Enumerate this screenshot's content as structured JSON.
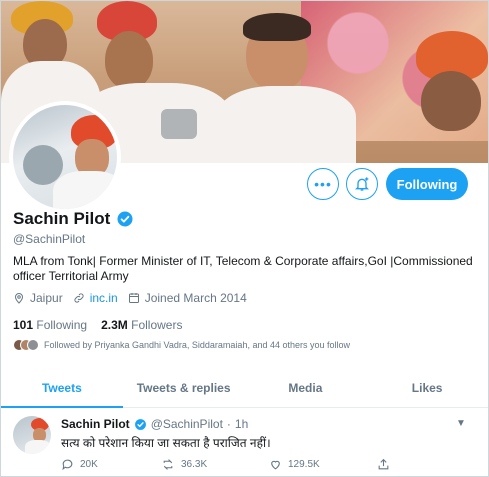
{
  "header": {
    "banner_alt": "",
    "buttons": {
      "more_icon": "more-horizontal-icon",
      "notify_icon": "bell-plus-icon",
      "follow_label": "Following"
    }
  },
  "profile": {
    "name": "Sachin Pilot",
    "verified_icon": "verified-badge-icon",
    "handle": "@SachinPilot",
    "bio": "MLA from Tonk| Former Minister of IT, Telecom & Corporate affairs,GoI |Commissioned officer Territorial Army",
    "location": "Jaipur",
    "website": "inc.in",
    "joined": "Joined March 2014",
    "following_count": "101",
    "following_label": "Following",
    "followers_count": "2.3M",
    "followers_label": "Followers",
    "followed_by": "Followed by Priyanka Gandhi Vadra, Siddaramaiah, and 44 others you follow"
  },
  "tabs": [
    {
      "label": "Tweets",
      "active": true
    },
    {
      "label": "Tweets & replies",
      "active": false
    },
    {
      "label": "Media",
      "active": false
    },
    {
      "label": "Likes",
      "active": false
    }
  ],
  "tweet": {
    "name": "Sachin Pilot",
    "handle": "@SachinPilot",
    "separator": "·",
    "time": "1h",
    "text": "सत्य को परेशान किया जा सकता है पराजित नहीं।",
    "replies": "20K",
    "retweets": "36.3K",
    "likes": "129.5K"
  },
  "colors": {
    "accent": "#1da1f2",
    "secondary_text": "#657786",
    "primary_text": "#14171a"
  }
}
